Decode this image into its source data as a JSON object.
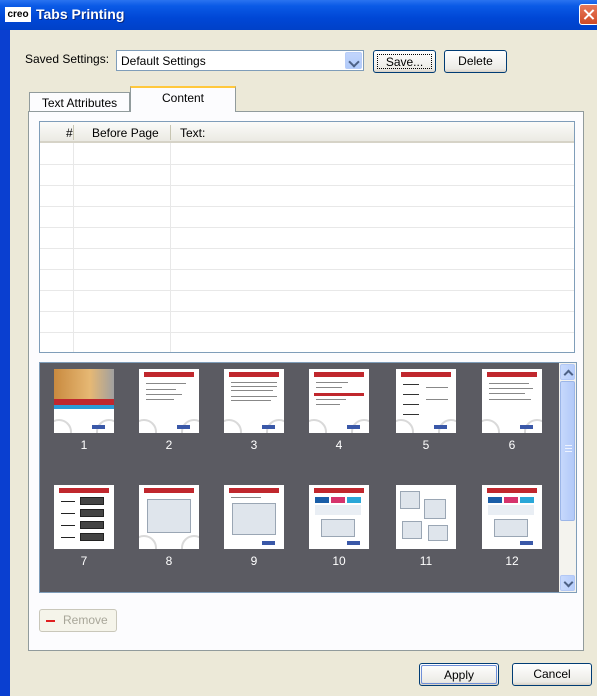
{
  "window": {
    "app_icon_text": "creo",
    "title": "Tabs Printing"
  },
  "settings": {
    "label": "Saved Settings:",
    "selected": "Default Settings",
    "save_label": "Save...",
    "delete_label": "Delete"
  },
  "tabs": [
    {
      "label": "Text Attributes",
      "active": false
    },
    {
      "label": "Content",
      "active": true
    }
  ],
  "table": {
    "columns": [
      "#",
      "Before Page",
      "Text:"
    ],
    "rows": []
  },
  "thumbnails": [
    {
      "page": "1"
    },
    {
      "page": "2"
    },
    {
      "page": "3"
    },
    {
      "page": "4"
    },
    {
      "page": "5"
    },
    {
      "page": "6"
    },
    {
      "page": "7"
    },
    {
      "page": "8"
    },
    {
      "page": "9"
    },
    {
      "page": "10"
    },
    {
      "page": "11"
    },
    {
      "page": "12"
    }
  ],
  "actions": {
    "remove_label": "Remove",
    "apply_label": "Apply",
    "cancel_label": "Cancel"
  },
  "colors": {
    "titlebar": "#0047d6",
    "dialog_bg": "#ece9d8",
    "thumb_panel_bg": "#5b5b62",
    "active_tab_accent": "#ffc83c",
    "page_header_red": "#c0272d"
  }
}
